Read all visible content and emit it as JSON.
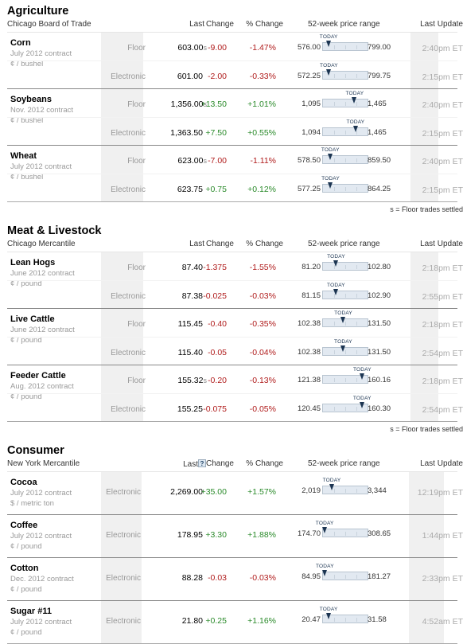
{
  "footnote": "s = Floor trades settled",
  "columns": {
    "last": "Last",
    "change": "Change",
    "pct_change": "% Change",
    "range": "52-week price range",
    "last_update": "Last Update",
    "today_label": "TODAY",
    "help_glyph": "?"
  },
  "colors": {
    "negative": "#b01c1c",
    "positive": "#2a8a2a",
    "marker": "#1c3552"
  },
  "sections": [
    {
      "title": "Agriculture",
      "source": "Chicago Board of Trade",
      "show_footnote": true,
      "groups": [
        {
          "name": "Corn",
          "contract": "July 2012 contract",
          "unit": "¢ / bushel",
          "rows": [
            {
              "label": "Floor",
              "last": "603.00",
              "settled": "s",
              "change": "-9.00",
              "pct": "-1.47%",
              "dir": "neg",
              "low": "576.00",
              "high": "799.00",
              "pos": 0.121,
              "updated": "2:40pm ET"
            },
            {
              "label": "Electronic",
              "last": "601.00",
              "settled": "",
              "change": "-2.00",
              "pct": "-0.33%",
              "dir": "neg",
              "low": "572.25",
              "high": "799.75",
              "pos": 0.126,
              "updated": "2:15pm ET"
            }
          ]
        },
        {
          "name": "Soybeans",
          "contract": "Nov. 2012 contract",
          "unit": "¢ / bushel",
          "rows": [
            {
              "label": "Floor",
              "last": "1,356.00",
              "settled": "s",
              "change": "+13.50",
              "pct": "+1.01%",
              "dir": "pos",
              "low": "1,095",
              "high": "1,465",
              "pos": 0.705,
              "updated": "2:40pm ET"
            },
            {
              "label": "Electronic",
              "last": "1,363.50",
              "settled": "",
              "change": "+7.50",
              "pct": "+0.55%",
              "dir": "pos",
              "low": "1,094",
              "high": "1,465",
              "pos": 0.724,
              "updated": "2:15pm ET"
            }
          ]
        },
        {
          "name": "Wheat",
          "contract": "July 2012 contract",
          "unit": "¢ / bushel",
          "rows": [
            {
              "label": "Floor",
              "last": "623.00",
              "settled": "s",
              "change": "-7.00",
              "pct": "-1.11%",
              "dir": "neg",
              "low": "578.50",
              "high": "859.50",
              "pos": 0.158,
              "updated": "2:40pm ET"
            },
            {
              "label": "Electronic",
              "last": "623.75",
              "settled": "",
              "change": "+0.75",
              "pct": "+0.12%",
              "dir": "pos",
              "low": "577.25",
              "high": "864.25",
              "pos": 0.162,
              "updated": "2:15pm ET"
            }
          ]
        }
      ]
    },
    {
      "title": "Meat & Livestock",
      "source": "Chicago Mercantile",
      "show_footnote": true,
      "groups": [
        {
          "name": "Lean Hogs",
          "contract": "June 2012 contract",
          "unit": "¢ / pound",
          "rows": [
            {
              "label": "Floor",
              "last": "87.40",
              "settled": "",
              "change": "-1.375",
              "pct": "-1.55%",
              "dir": "neg",
              "low": "81.20",
              "high": "102.80",
              "pos": 0.287,
              "updated": "2:18pm ET"
            },
            {
              "label": "Electronic",
              "last": "87.38",
              "settled": "",
              "change": "-0.025",
              "pct": "-0.03%",
              "dir": "neg",
              "low": "81.15",
              "high": "102.90",
              "pos": 0.286,
              "updated": "2:55pm ET"
            }
          ]
        },
        {
          "name": "Live Cattle",
          "contract": "June 2012 contract",
          "unit": "¢ / pound",
          "rows": [
            {
              "label": "Floor",
              "last": "115.45",
              "settled": "",
              "change": "-0.40",
              "pct": "-0.35%",
              "dir": "neg",
              "low": "102.38",
              "high": "131.50",
              "pos": 0.449,
              "updated": "2:18pm ET"
            },
            {
              "label": "Electronic",
              "last": "115.40",
              "settled": "",
              "change": "-0.05",
              "pct": "-0.04%",
              "dir": "neg",
              "low": "102.38",
              "high": "131.50",
              "pos": 0.447,
              "updated": "2:54pm ET"
            }
          ]
        },
        {
          "name": "Feeder Cattle",
          "contract": "Aug. 2012 contract",
          "unit": "¢ / pound",
          "rows": [
            {
              "label": "Floor",
              "last": "155.32",
              "settled": "s",
              "change": "-0.20",
              "pct": "-0.13%",
              "dir": "neg",
              "low": "121.38",
              "high": "160.16",
              "pos": 0.875,
              "updated": "2:18pm ET"
            },
            {
              "label": "Electronic",
              "last": "155.25",
              "settled": "",
              "change": "-0.075",
              "pct": "-0.05%",
              "dir": "neg",
              "low": "120.45",
              "high": "160.30",
              "pos": 0.873,
              "updated": "2:54pm ET"
            }
          ]
        }
      ]
    },
    {
      "title": "Consumer",
      "source": "New York Mercantile",
      "show_footnote": false,
      "single": true,
      "groups": [
        {
          "name": "Cocoa",
          "contract": "July 2012 contract",
          "unit": "$ / metric ton",
          "rows": [
            {
              "label": "Electronic",
              "last": "2,269.00",
              "settled": "",
              "change": "+35.00",
              "pct": "+1.57%",
              "dir": "pos",
              "low": "2,019",
              "high": "3,344",
              "pos": 0.189,
              "updated": "12:19pm ET"
            }
          ]
        },
        {
          "name": "Coffee",
          "contract": "July 2012 contract",
          "unit": "¢ / pound",
          "rows": [
            {
              "label": "Electronic",
              "last": "178.95",
              "settled": "",
              "change": "+3.30",
              "pct": "+1.88%",
              "dir": "pos",
              "low": "174.70",
              "high": "308.65",
              "pos": 0.032,
              "updated": "1:44pm ET"
            }
          ]
        },
        {
          "name": "Cotton",
          "contract": "Dec. 2012 contract",
          "unit": "¢ / pound",
          "rows": [
            {
              "label": "Electronic",
              "last": "88.28",
              "settled": "",
              "change": "-0.03",
              "pct": "-0.03%",
              "dir": "neg",
              "low": "84.95",
              "high": "181.27",
              "pos": 0.035,
              "updated": "2:33pm ET"
            }
          ]
        },
        {
          "name": "Sugar #11",
          "contract": "July 2012 contract",
          "unit": "¢ / pound",
          "rows": [
            {
              "label": "Electronic",
              "last": "21.80",
              "settled": "",
              "change": "+0.25",
              "pct": "+1.16%",
              "dir": "pos",
              "low": "20.47",
              "high": "31.58",
              "pos": 0.12,
              "updated": "4:52am ET"
            }
          ]
        }
      ]
    }
  ]
}
